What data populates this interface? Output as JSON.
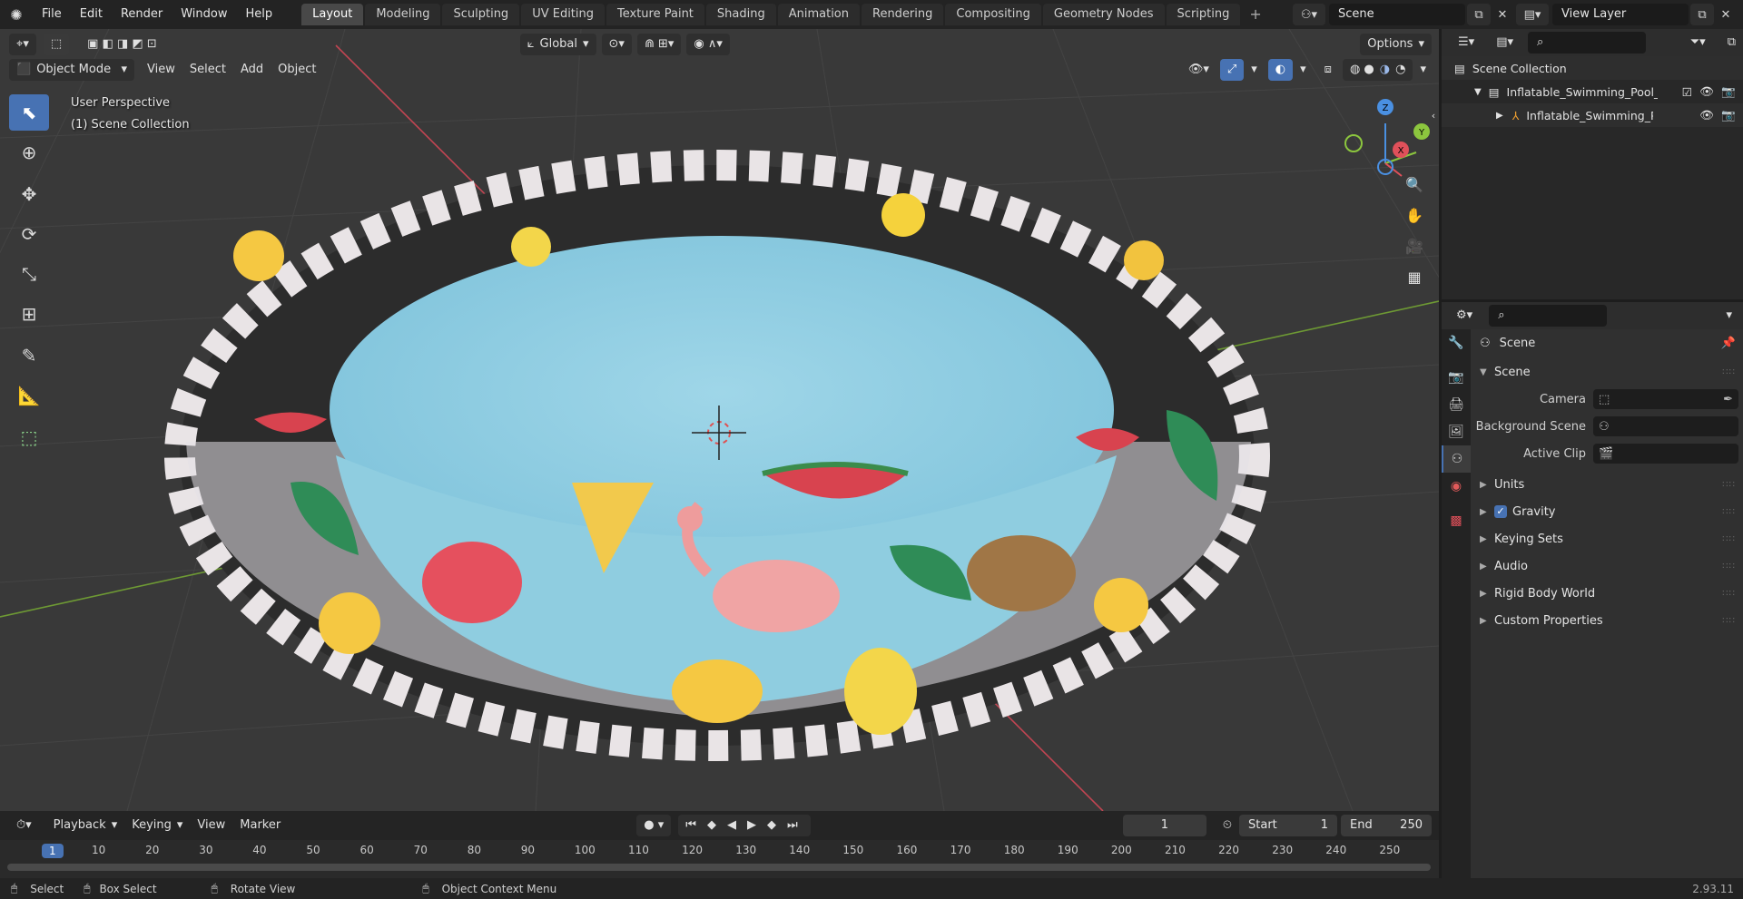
{
  "topbar": {
    "menu": [
      "File",
      "Edit",
      "Render",
      "Window",
      "Help"
    ],
    "workspaces": [
      "Layout",
      "Modeling",
      "Sculpting",
      "UV Editing",
      "Texture Paint",
      "Shading",
      "Animation",
      "Rendering",
      "Compositing",
      "Geometry Nodes",
      "Scripting"
    ],
    "active_workspace": "Layout",
    "scene": "Scene",
    "view_layer": "View Layer"
  },
  "viewport": {
    "mode": "Object Mode",
    "menus": [
      "View",
      "Select",
      "Add",
      "Object"
    ],
    "transform_orientation": "Global",
    "options_label": "Options",
    "perspective_label": "User Perspective",
    "collection_label": "(1) Scene Collection",
    "gizmo_axes": [
      "Z",
      "Y",
      "X"
    ]
  },
  "timeline": {
    "menus": [
      "Playback",
      "Keying",
      "View",
      "Marker"
    ],
    "current_frame": "1",
    "start_label": "Start",
    "start": "1",
    "end_label": "End",
    "end": "250",
    "ruler": [
      "1",
      "10",
      "20",
      "30",
      "40",
      "50",
      "60",
      "70",
      "80",
      "90",
      "100",
      "110",
      "120",
      "130",
      "140",
      "150",
      "160",
      "170",
      "180",
      "190",
      "200",
      "210",
      "220",
      "230",
      "240",
      "250"
    ]
  },
  "statusbar": {
    "select": "Select",
    "box_select": "Box Select",
    "rotate_view": "Rotate View",
    "context_menu": "Object Context Menu",
    "version": "2.93.11"
  },
  "outliner": {
    "root": "Scene Collection",
    "items": [
      {
        "label": "Inflatable_Swimming_Pool_Tr"
      },
      {
        "label": "Inflatable_Swimming_Poo"
      }
    ]
  },
  "properties": {
    "context": "Scene",
    "panel_title": "Scene",
    "camera_label": "Camera",
    "background_scene_label": "Background Scene",
    "active_clip_label": "Active Clip",
    "sections": [
      "Units",
      "Gravity",
      "Keying Sets",
      "Audio",
      "Rigid Body World",
      "Custom Properties"
    ]
  },
  "colors": {
    "accent": "#4772b3",
    "water": "#8fcde0",
    "axis_x": "#e0505a",
    "axis_y": "#8cc63e",
    "axis_z": "#4a90e2"
  }
}
